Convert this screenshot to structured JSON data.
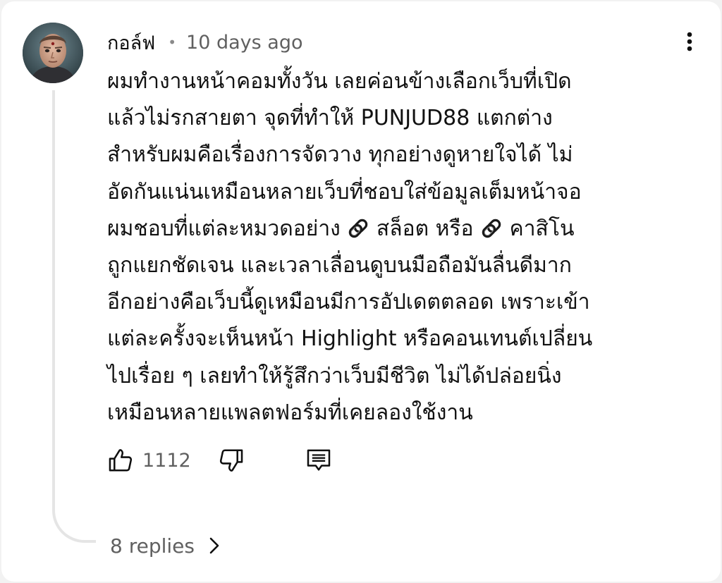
{
  "comment": {
    "author": "กอล์ฟ",
    "separator": "•",
    "time": "10 days ago",
    "lines": [
      {
        "text": "ผมทำงานหน้าคอมทั้งวัน เลยค่อนข้างเลือกเว็บที่เปิด"
      },
      {
        "text": "แล้วไม่รกสายตา จุดที่ทำให้ PUNJUD88 แตกต่าง"
      },
      {
        "text": "สำหรับผมคือเรื่องการจัดวาง ทุกอย่างดูหายใจได้ ไม่"
      },
      {
        "text": "อัดกันแน่นเหมือนหลายเว็บที่ชอบใส่ข้อมูลเต็มหน้าจอ"
      },
      {
        "a": "ผมชอบที่แต่ละหมวดอย่าง ",
        "b": " สล็อต หรือ ",
        "c": " คาสิโน"
      },
      {
        "text": "ถูกแยกชัดเจน และเวลาเลื่อนดูบนมือถือมันลื่นดีมาก"
      },
      {
        "text": "อีกอย่างคือเว็บนี้ดูเหมือนมีการอัปเดตตลอด เพราะเข้า"
      },
      {
        "text": "แต่ละครั้งจะเห็นหน้า Highlight หรือคอนเทนต์เปลี่ยน"
      },
      {
        "text": "ไปเรื่อย ๆ เลยทำให้รู้สึกว่าเว็บมีชีวิต ไม่ได้ปล่อยนิ่ง"
      },
      {
        "text": "เหมือนหลายแพลตฟอร์มที่เคยลองใช้งาน"
      }
    ],
    "emoji_icon": "link-emoji-icon"
  },
  "actions": {
    "like_count": "1112",
    "like_icon": "thumbs-up-icon",
    "dislike_icon": "thumbs-down-icon",
    "reply_icon": "comment-icon"
  },
  "replies": {
    "label": "8 replies",
    "icon": "chevron-right-icon"
  },
  "colors": {
    "text": "#111111",
    "secondary": "#606060",
    "thread_line": "#e5e5e5",
    "background": "#ffffff"
  }
}
